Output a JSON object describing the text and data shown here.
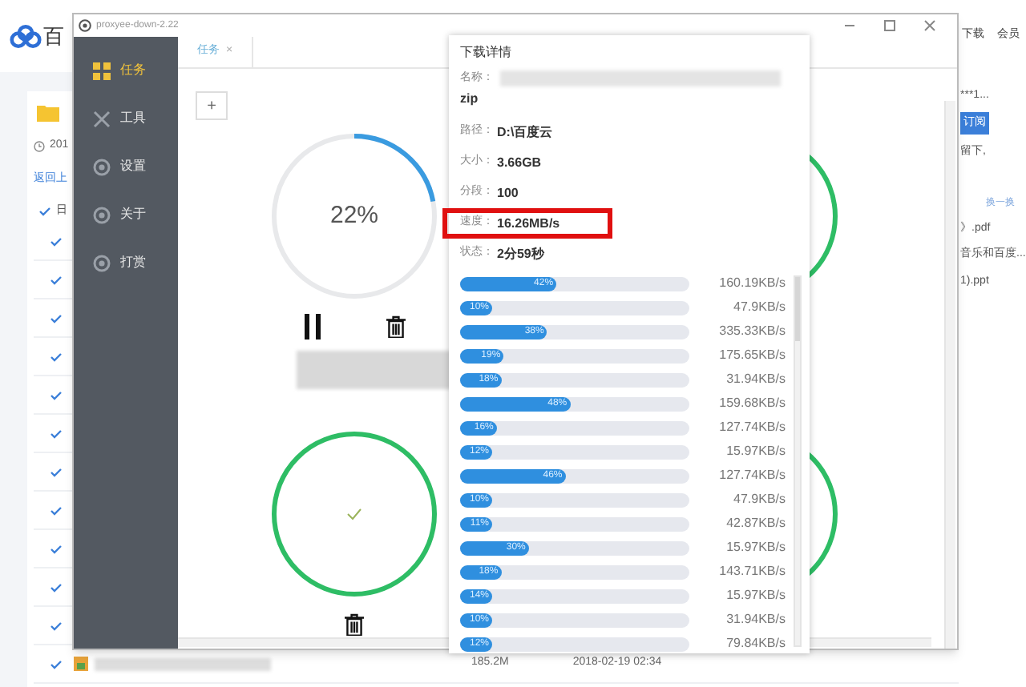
{
  "background_page": {
    "logo": "百",
    "date": "201",
    "back_link": "返回上",
    "check_all": {
      "label": "日",
      "checked": true
    },
    "rows": [
      {
        "checked": true
      },
      {
        "checked": true
      },
      {
        "checked": true
      },
      {
        "checked": true
      },
      {
        "checked": true
      },
      {
        "checked": true
      },
      {
        "checked": true
      },
      {
        "checked": true
      },
      {
        "checked": true
      },
      {
        "checked": true
      },
      {
        "checked": true
      },
      {
        "checked": true,
        "size": "185.2M",
        "date": "2018-02-19 02:34"
      }
    ],
    "header_links": [
      "下载",
      "会员"
    ],
    "right_panel": {
      "user": "***1...",
      "subscribe_button": "订阅",
      "note": "留下,",
      "refresh_link": "换一换",
      "files": [
        "》.pdf",
        "音乐和百度...",
        "1).ppt"
      ]
    }
  },
  "downloader": {
    "title": "proxyee-down-2.22",
    "nav": [
      {
        "label": "任务",
        "selected": true
      },
      {
        "label": "工具",
        "selected": false
      },
      {
        "label": "设置",
        "selected": false
      },
      {
        "label": "关于",
        "selected": false
      },
      {
        "label": "打赏",
        "selected": false
      }
    ],
    "tabs": [
      {
        "label": "任务",
        "close": "×",
        "selected": true
      }
    ],
    "add_button": "+",
    "tasks": [
      {
        "kind": "progress",
        "level": 0.22,
        "percent": "22%"
      },
      {
        "kind": "complete"
      },
      {
        "kind": "complete"
      },
      {
        "kind": "complete"
      }
    ]
  },
  "detail_popup": {
    "title": "下载详情",
    "fields": [
      {
        "label": "名称：",
        "value": "zip",
        "kind": "name",
        "highlighted": false
      },
      {
        "label": "路径：",
        "value": "D:\\百度云",
        "kind": "plain",
        "highlighted": false
      },
      {
        "label": "大小：",
        "value": "3.66GB",
        "kind": "plain",
        "highlighted": false
      },
      {
        "label": "分段：",
        "value": "100",
        "kind": "plain",
        "highlighted": false
      },
      {
        "label": "速度：",
        "value": "16.26MB/s",
        "kind": "plain",
        "highlighted": true
      },
      {
        "label": "状态：",
        "value": "2分59秒",
        "kind": "plain",
        "highlighted": false
      }
    ],
    "segments": [
      {
        "level": 0.42,
        "percent": "42%",
        "speed": "160.19KB/s"
      },
      {
        "level": 0.1,
        "percent": "10%",
        "speed": "47.9KB/s"
      },
      {
        "level": 0.38,
        "percent": "38%",
        "speed": "335.33KB/s"
      },
      {
        "level": 0.19,
        "percent": "19%",
        "speed": "175.65KB/s"
      },
      {
        "level": 0.18,
        "percent": "18%",
        "speed": "31.94KB/s"
      },
      {
        "level": 0.48,
        "percent": "48%",
        "speed": "159.68KB/s"
      },
      {
        "level": 0.16,
        "percent": "16%",
        "speed": "127.74KB/s"
      },
      {
        "level": 0.12,
        "percent": "12%",
        "speed": "15.97KB/s"
      },
      {
        "level": 0.46,
        "percent": "46%",
        "speed": "127.74KB/s"
      },
      {
        "level": 0.1,
        "percent": "10%",
        "speed": "47.9KB/s"
      },
      {
        "level": 0.11,
        "percent": "11%",
        "speed": "42.87KB/s"
      },
      {
        "level": 0.3,
        "percent": "30%",
        "speed": "15.97KB/s"
      },
      {
        "level": 0.18,
        "percent": "18%",
        "speed": "143.71KB/s"
      },
      {
        "level": 0.14,
        "percent": "14%",
        "speed": "15.97KB/s"
      },
      {
        "level": 0.1,
        "percent": "10%",
        "speed": "31.94KB/s"
      },
      {
        "level": 0.12,
        "percent": "12%",
        "speed": "79.84KB/s"
      }
    ]
  }
}
